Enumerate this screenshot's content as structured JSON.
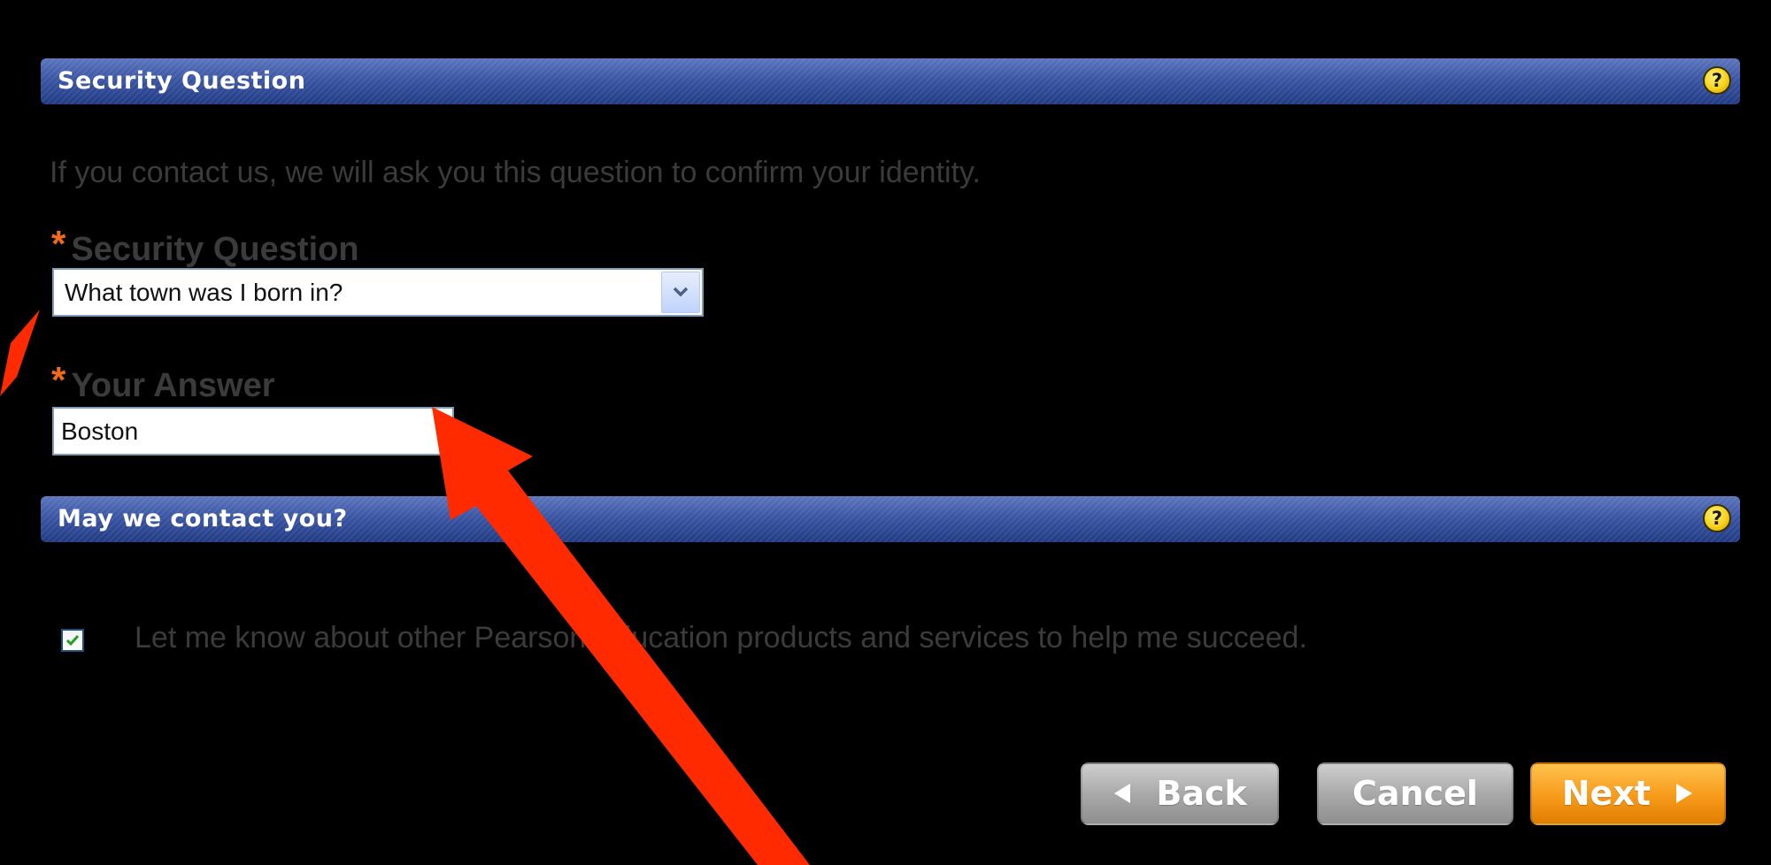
{
  "sections": {
    "security": {
      "title": "Security Question",
      "help": "?"
    },
    "contact": {
      "title": "May we contact you?",
      "help": "?"
    }
  },
  "intro": "If you contact us, we will ask you this question to confirm your identity.",
  "form": {
    "required_marker": "*",
    "question_label": "Security Question",
    "question_value": "What town was I born in?",
    "answer_label": "Your Answer",
    "answer_value": "Boston"
  },
  "opt_in": {
    "checked": true,
    "label": "Let me know about other Pearson Education products and services to help me succeed."
  },
  "buttons": {
    "back": "Back",
    "cancel": "Cancel",
    "next": "Next"
  },
  "colors": {
    "section_bar": "#2c4590",
    "required_star": "#f26a1b",
    "next_button": "#f79a1a",
    "secondary_button": "#a9a9a9",
    "annotation_arrow": "#ff2a00"
  },
  "icons": {
    "help": "question-mark-help-icon",
    "select_arrow": "chevron-down-icon",
    "checkbox": "checkmark-icon",
    "back": "triangle-left-icon",
    "next": "triangle-right-icon"
  }
}
